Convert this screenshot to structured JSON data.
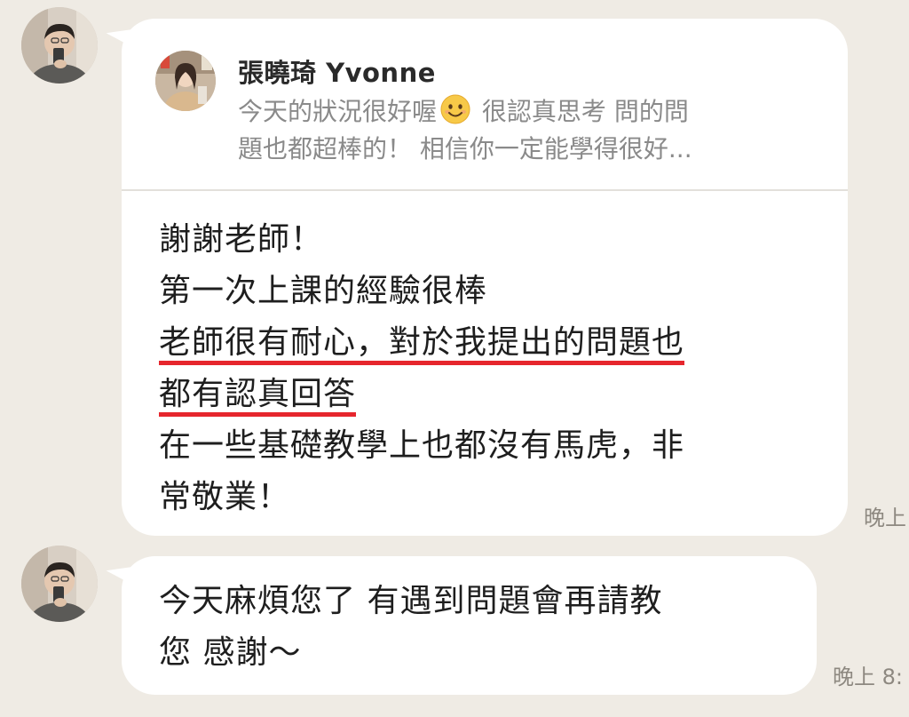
{
  "messages": [
    {
      "reply": {
        "sender": "張曉琦 Yvonne",
        "preview_lines": [
          {
            "before": "今天的狀況很好喔",
            "emoji": "smiling-face-emoji",
            "after": " 很認真思考 問的問"
          },
          {
            "text": "題也都超棒的！ 相信你一定能學得很好..."
          }
        ]
      },
      "lines": [
        {
          "text": "謝謝老師！",
          "underlined": false
        },
        {
          "text": "第一次上課的經驗很棒",
          "underlined": false
        },
        {
          "text": "老師很有耐心，對於我提出的問題也",
          "underlined": true
        },
        {
          "text": "都有認真回答",
          "underlined": true
        },
        {
          "text": "在一些基礎教學上也都沒有馬虎，非",
          "underlined": false
        },
        {
          "text": "常敬業！",
          "underlined": false
        }
      ],
      "time": "晚上"
    },
    {
      "lines": [
        {
          "text": "今天麻煩您了 有遇到問題會再請教"
        },
        {
          "text": "您 感謝～"
        }
      ],
      "time": "晚上 8:"
    }
  ],
  "colors": {
    "background": "#efebe4",
    "bubble": "#ffffff",
    "highlight_underline": "#e6262d"
  }
}
